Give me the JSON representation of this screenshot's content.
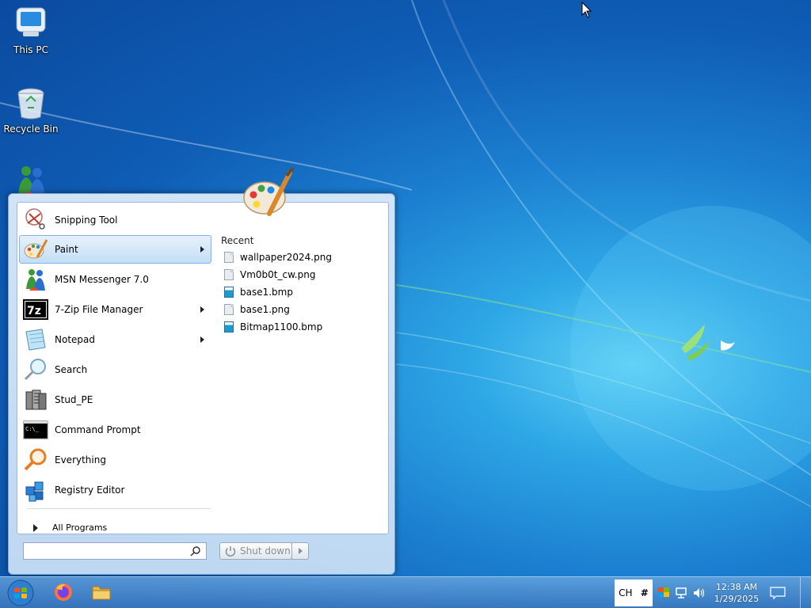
{
  "desktop": {
    "icons": [
      {
        "label": "This PC",
        "icon": "computer-icon"
      },
      {
        "label": "Recycle Bin",
        "icon": "recycle-bin-icon"
      },
      {
        "label": "",
        "icon": "msn-messenger-icon"
      }
    ]
  },
  "start_menu": {
    "pinned": [
      {
        "label": "Snipping Tool",
        "icon": "scissors-icon",
        "submenu": false
      },
      {
        "label": "Paint",
        "icon": "paint-palette-icon",
        "submenu": true,
        "highlighted": true
      },
      {
        "label": "MSN Messenger 7.0",
        "icon": "messenger-buddies-icon",
        "submenu": false
      },
      {
        "label": "7-Zip File Manager",
        "icon": "7zip-icon",
        "submenu": true
      },
      {
        "label": "Notepad",
        "icon": "notepad-icon",
        "submenu": true
      },
      {
        "label": "Search",
        "icon": "magnifier-icon",
        "submenu": false
      },
      {
        "label": "Stud_PE",
        "icon": "stud-pe-icon",
        "submenu": false
      },
      {
        "label": "Command Prompt",
        "icon": "console-icon",
        "submenu": false
      },
      {
        "label": "Everything",
        "icon": "everything-search-icon",
        "submenu": false
      },
      {
        "label": "Registry Editor",
        "icon": "registry-cubes-icon",
        "submenu": false
      }
    ],
    "all_programs": "All Programs",
    "recent_title": "Recent",
    "recent": [
      {
        "label": "wallpaper2024.png",
        "type": "png"
      },
      {
        "label": "Vm0b0t_cw.png",
        "type": "png"
      },
      {
        "label": "base1.bmp",
        "type": "bmp"
      },
      {
        "label": "base1.png",
        "type": "png"
      },
      {
        "label": "Bitmap1100.bmp",
        "type": "bmp"
      }
    ],
    "search_placeholder": "",
    "shutdown_label": "Shut down"
  },
  "taskbar": {
    "pinned": [
      "firefox-icon",
      "file-explorer-icon"
    ],
    "language": "CH",
    "ime": "#",
    "clock_time": "12:38 AM",
    "clock_date": "1/29/2025"
  },
  "colors": {
    "accent": "#1c7fd0",
    "highlight": "#c3def6"
  }
}
